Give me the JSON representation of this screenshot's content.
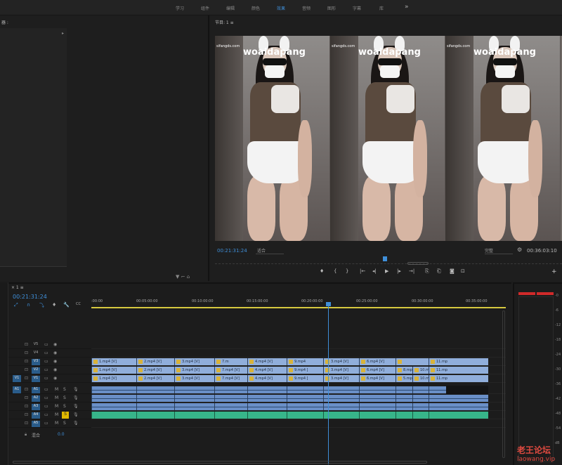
{
  "workspace": {
    "tabs": [
      "学习",
      "组件",
      "编辑",
      "颜色",
      "效果",
      "音频",
      "图形",
      "字幕",
      "库"
    ],
    "active_index": 4,
    "more": "»"
  },
  "source": {
    "title": "器 :",
    "arrow": "▸",
    "tools": "▼ ⌐ ⌂"
  },
  "program": {
    "title": "节目: 1  ≡",
    "watermark": "woaidapang",
    "site": "sifangds.com",
    "timecode": "00:21:31:24",
    "fit": "适合",
    "quality": "完整",
    "duration": "00:36:03:10",
    "add": "+"
  },
  "transport": [
    "♦",
    "{",
    "}",
    "|←",
    "◂|",
    "▶",
    "|▸",
    "→|",
    "⎘",
    "⎗",
    "◙",
    "⊡"
  ],
  "timeline": {
    "tab": "× 1  ≡",
    "timecode": "00:21:31:24",
    "tools": [
      "⤢",
      "∩",
      "⤵",
      "♦",
      "🔧",
      "CC"
    ],
    "ruler": [
      ":00:00",
      "00:05:00:00",
      "00:10:00:00",
      "00:15:00:00",
      "00:20:00:00",
      "00:25:00:00",
      "00:30:00:00",
      "00:35:00:00"
    ],
    "video_tracks": [
      {
        "name": "V5",
        "source": "",
        "clips": []
      },
      {
        "name": "V4",
        "source": "",
        "clips": []
      },
      {
        "name": "V3",
        "source": "",
        "clips": [
          "1.mp4 [V]",
          "2.mp4 [V]",
          "3.mp4 [V]",
          "7.m",
          "4.mp4 [V]",
          "9.mp4",
          "3.mp4 [V]",
          "6.mp4 [V]",
          "",
          "11.mp"
        ]
      },
      {
        "name": "V2",
        "source": "",
        "clips": [
          "1.mp4 [V]",
          "2.mp4 [V]",
          "3.mp4 [V]",
          "7.mp4 [V]",
          "4.mp4 [V]",
          "9.mp4 [",
          "3.mp4 [V]",
          "6.mp4 [V]",
          "8.mp4 [V]",
          "10.mp4",
          "11.mp"
        ]
      },
      {
        "name": "V1",
        "source": "V1",
        "clips": [
          "1.mp4 [V]",
          "2.mp4 [V]",
          "3.mp4 [V]",
          "7.mp4 [V]",
          "4.mp4 [V]",
          "9.mp4 [",
          "3.mp4 [V]",
          "6.mp4 [V]",
          "5.mp4 [V]",
          "10.mp4",
          "11.mp"
        ]
      }
    ],
    "audio_tracks": [
      {
        "name": "A1",
        "source": "A1"
      },
      {
        "name": "A2",
        "source": ""
      },
      {
        "name": "A3",
        "source": ""
      },
      {
        "name": "A4",
        "source": ""
      },
      {
        "name": "A5",
        "source": ""
      }
    ],
    "mix_label": "混合",
    "mix_value": "0.0",
    "track_controls": {
      "mute": "M",
      "solo": "S"
    }
  },
  "meters": {
    "db_marks": [
      "-0",
      "-6",
      "-12",
      "-18",
      "-24",
      "-30",
      "-36",
      "-42",
      "-48",
      "-54",
      "dB"
    ]
  },
  "forum": {
    "name": "老王论坛",
    "url": "laowang.vip"
  },
  "colors": {
    "accent": "#3f8fd9",
    "clip_video": "#90aedb",
    "clip_audio": "#6a8fc7",
    "clip_green": "#37b58a",
    "workarea": "#d6c93f",
    "watermark_red": "#e04a40"
  }
}
